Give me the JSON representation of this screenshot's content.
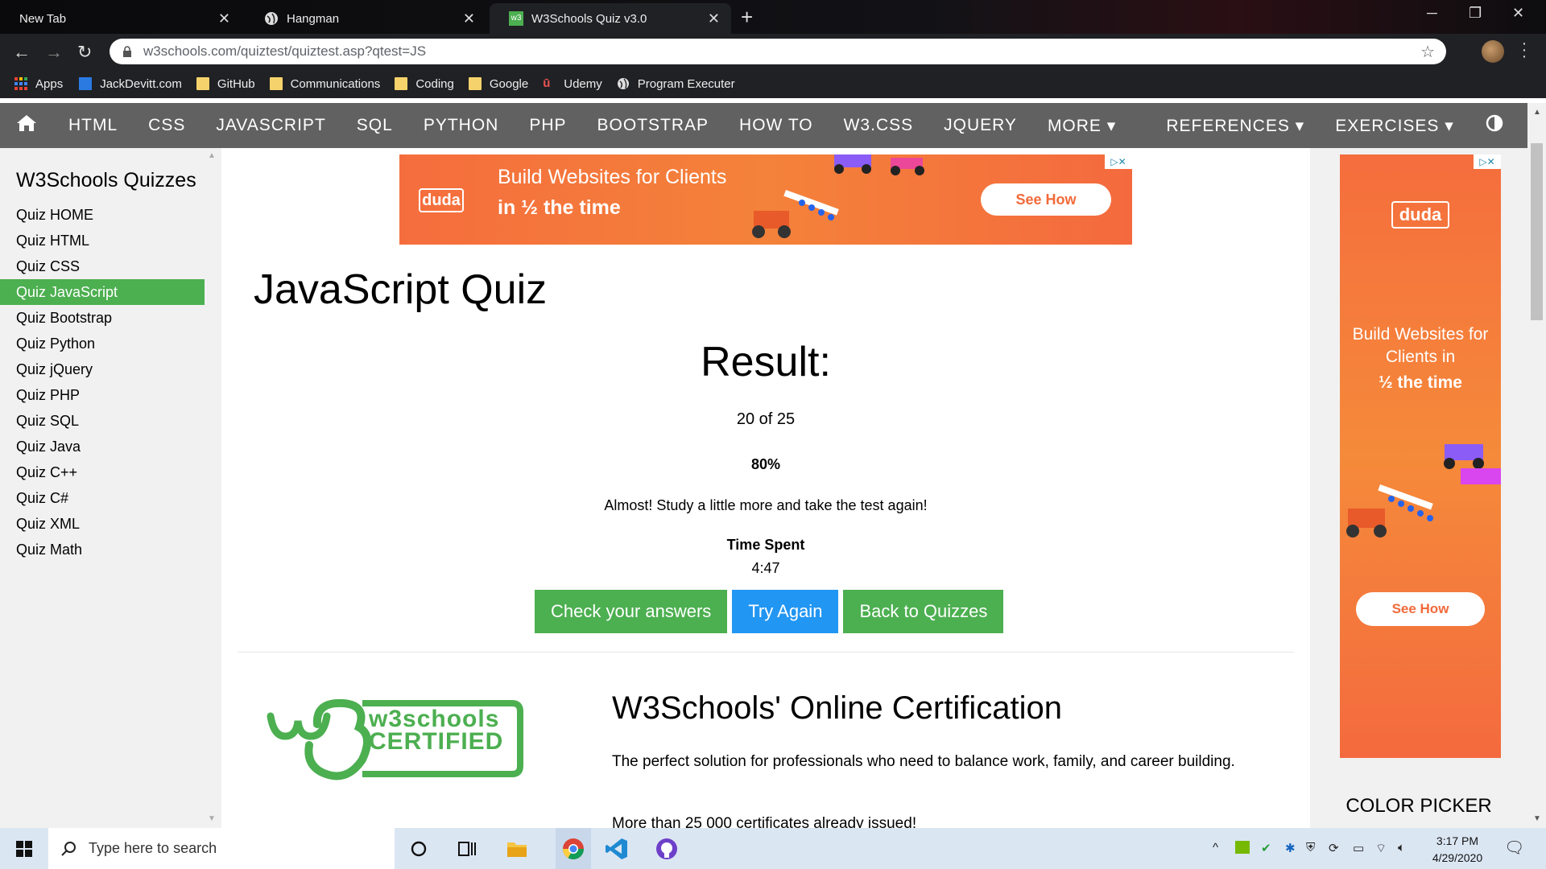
{
  "browser": {
    "tabs": [
      {
        "label": "New Tab"
      },
      {
        "label": "Hangman"
      },
      {
        "label": "W3Schools Quiz v3.0"
      }
    ],
    "url": "w3schools.com/quiztest/quiztest.asp?qtest=JS",
    "bookmarks": [
      "Apps",
      "JackDevitt.com",
      "GitHub",
      "Communications",
      "Coding",
      "Google",
      "Udemy",
      "Program Executer"
    ]
  },
  "topnav": {
    "items": [
      "HTML",
      "CSS",
      "JAVASCRIPT",
      "SQL",
      "PYTHON",
      "PHP",
      "BOOTSTRAP",
      "HOW TO",
      "W3.CSS",
      "JQUERY",
      "MORE ▾",
      "REFERENCES ▾",
      "EXERCISES ▾"
    ]
  },
  "sidebar": {
    "title": "W3Schools Quizzes",
    "links": [
      "Quiz HOME",
      "Quiz HTML",
      "Quiz CSS",
      "Quiz JavaScript",
      "Quiz Bootstrap",
      "Quiz Python",
      "Quiz jQuery",
      "Quiz PHP",
      "Quiz SQL",
      "Quiz Java",
      "Quiz C++",
      "Quiz C#",
      "Quiz XML",
      "Quiz Math"
    ],
    "active": "Quiz JavaScript"
  },
  "ad_banner": {
    "brand": "duda",
    "line1": "Build Websites for Clients",
    "line2": "in ½ the time",
    "cta": "See How"
  },
  "main": {
    "title": "JavaScript Quiz",
    "result_heading": "Result:",
    "score": "20 of 25",
    "percent": "80%",
    "message": "Almost! Study a little more and take the test again!",
    "time_label": "Time Spent",
    "time_value": "4:47",
    "buttons": {
      "check": "Check your answers",
      "retry": "Try Again",
      "back": "Back to Quizzes"
    },
    "cert": {
      "logo_text": "w3schools CERTIFIED",
      "heading": "W3Schools' Online Certification",
      "para": "The perfect solution for professionals who need to balance work, family, and career building.",
      "para2": "More than 25 000 certificates already issued!"
    }
  },
  "ad_side": {
    "brand": "duda",
    "line1": "Build Websites for Clients in",
    "line2": "½ the time",
    "cta": "See How"
  },
  "right": {
    "color_picker": "COLOR PICKER"
  },
  "taskbar": {
    "search_placeholder": "Type here to search",
    "time": "3:17 PM",
    "date": "4/29/2020"
  }
}
